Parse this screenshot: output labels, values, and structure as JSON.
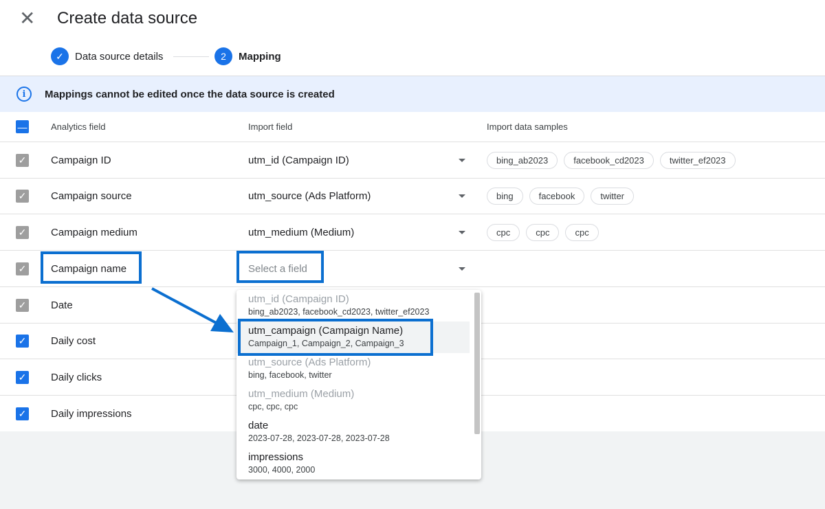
{
  "header": {
    "title": "Create data source",
    "close_icon": "close-icon"
  },
  "stepper": {
    "steps": [
      {
        "label": "Data source details",
        "state": "done"
      },
      {
        "label": "Mapping",
        "number": "2",
        "state": "active"
      }
    ]
  },
  "banner": {
    "text": "Mappings cannot be edited once the data source is created",
    "icon": "info-icon"
  },
  "table": {
    "headers": [
      "Analytics field",
      "Import field",
      "Import data samples"
    ],
    "rows": [
      {
        "field": "Campaign ID",
        "import": "utm_id (Campaign ID)",
        "samples": [
          "bing_ab2023",
          "facebook_cd2023",
          "twitter_ef2023"
        ],
        "checkbox": "disabled-checked"
      },
      {
        "field": "Campaign source",
        "import": "utm_source (Ads Platform)",
        "samples": [
          "bing",
          "facebook",
          "twitter"
        ],
        "checkbox": "disabled-checked"
      },
      {
        "field": "Campaign medium",
        "import": "utm_medium (Medium)",
        "samples": [
          "cpc",
          "cpc",
          "cpc"
        ],
        "checkbox": "disabled-checked"
      },
      {
        "field": "Campaign name",
        "placeholder": "Select a field",
        "checkbox": "disabled-checked"
      },
      {
        "field": "Date",
        "checkbox": "disabled-checked"
      },
      {
        "field": "Daily cost",
        "checkbox": "checked"
      },
      {
        "field": "Daily clicks",
        "checkbox": "checked"
      },
      {
        "field": "Daily impressions",
        "checkbox": "checked"
      }
    ]
  },
  "dropdown": {
    "options": [
      {
        "label": "utm_id (Campaign ID)",
        "samples": "bing_ab2023, facebook_cd2023, twitter_ef2023",
        "disabled": true
      },
      {
        "label": "utm_campaign (Campaign Name)",
        "samples": "Campaign_1, Campaign_2, Campaign_3",
        "highlighted": true
      },
      {
        "label": "utm_source (Ads Platform)",
        "samples": "bing, facebook, twitter",
        "disabled": true
      },
      {
        "label": "utm_medium (Medium)",
        "samples": "cpc, cpc, cpc",
        "disabled": true
      },
      {
        "label": "date",
        "samples": "2023-07-28, 2023-07-28, 2023-07-28"
      },
      {
        "label": "impressions",
        "samples": "3000, 4000, 2000"
      }
    ]
  },
  "colors": {
    "accent": "#1a73e8",
    "annotation": "#0b6fd0",
    "banner_bg": "#e8f0fe"
  }
}
